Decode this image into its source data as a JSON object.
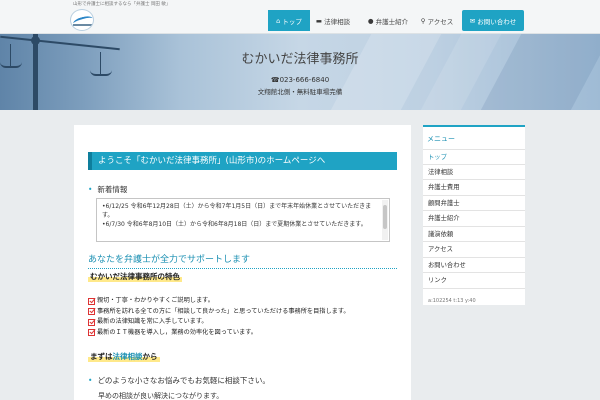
{
  "header": {
    "tagline": "山形で弁護士に相談するなら「弁護士 岡田 敏」",
    "nav": [
      {
        "label": "トップ",
        "icon": "home-icon"
      },
      {
        "label": "法律相談",
        "icon": "chat-icon"
      },
      {
        "label": "弁護士紹介",
        "icon": "user-icon"
      },
      {
        "label": "アクセス",
        "icon": "location-pin-icon"
      },
      {
        "label": "お問い合わせ",
        "icon": "mail-icon"
      }
    ]
  },
  "hero": {
    "office_name": "むかいだ法律事務所",
    "phone": "☎023-666-6840",
    "address": "文翔館北側・無料駐車場完備"
  },
  "main": {
    "welcome": "ようこそ「むかいだ法律事務所」(山形市)のホームページへ",
    "news_heading": "新着情報",
    "news": [
      "•6/12/25 令和6年12月28日（土）から令和7年1月5日（日）まで年末年始休業とさせていただきます。",
      "•6/7/30 令和6年8月10日（土）から令和6年8月18日（日）まで夏期休業とさせていただきます。"
    ],
    "support_heading": "あなたを弁護士が全力でサポートします",
    "features_heading": "むかいだ法律事務所の特色",
    "features": [
      "親切・丁寧・わかりやすくご説明します。",
      "事務所を訪れる全ての方に「相談して良かった」と思っていただける事務所を目指します。",
      "最新の法律知識を常に入手しています。",
      "最新のＩＴ機器を導入し，業務の効率化を図っています。"
    ],
    "first_consult_prefix": "まずは",
    "first_consult_link": "法律相談",
    "first_consult_suffix": "から",
    "bullet_text": "どのような小さなお悩みでもお気軽に相談下さい。",
    "bullet_text2": "早めの相談が良い解決につながります。"
  },
  "sidebar": {
    "title": "メニュー",
    "items": [
      "トップ",
      "法律相談",
      "弁護士費用",
      "顧問弁護士",
      "弁護士紹介",
      "議演依頼",
      "アクセス",
      "お問い合わせ",
      "リンク"
    ],
    "counter": "a:102254 t:13 y:40"
  },
  "colors": {
    "accent": "#1fa3c4",
    "accent_dark": "#1a8fb2",
    "highlight": "#ffe98a",
    "check": "#dd3333"
  }
}
